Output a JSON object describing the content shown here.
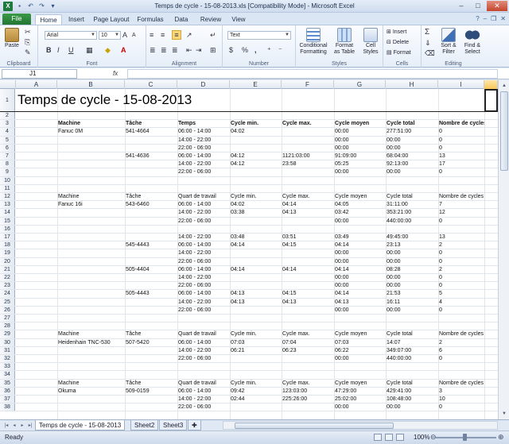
{
  "app": {
    "window_title": "Temps de cycle - 15-08-2013.xls  [Compatibility Mode]  -  Microsoft Excel",
    "logo_letter": "X",
    "accent_color": "#217346"
  },
  "ribbon_tabs": [
    "File",
    "Home",
    "Insert",
    "Page Layout",
    "Formulas",
    "Data",
    "Review",
    "View"
  ],
  "ribbon": {
    "clipboard": {
      "paste": "Paste",
      "label": "Clipboard"
    },
    "font": {
      "name": "Arial",
      "size": "10",
      "label": "Font",
      "bold": "B",
      "italic": "I",
      "underline": "U"
    },
    "alignment": {
      "label": "Alignment"
    },
    "number": {
      "format": "Text",
      "label": "Number",
      "percent": "%",
      "comma": ","
    },
    "styles": {
      "conditional": "Conditional Formatting",
      "format_table": "Format as Table",
      "cell_styles": "Cell Styles",
      "label": "Styles"
    },
    "cells": {
      "insert": "Insert",
      "delete": "Delete",
      "format": "Format",
      "label": "Cells"
    },
    "editing": {
      "sort": "Sort & Filter",
      "find": "Find & Select",
      "label": "Editing",
      "sigma": "Σ"
    }
  },
  "formula_bar": {
    "name_box": "J1",
    "fx": "fx",
    "value": ""
  },
  "columns": [
    "A",
    "B",
    "C",
    "D",
    "E",
    "F",
    "G",
    "H",
    "I"
  ],
  "sheet": {
    "title": "Temps de cycle - 15-08-2013",
    "rows": [
      {
        "n": "2",
        "c": [
          "",
          "",
          "",
          "",
          "",
          "",
          "",
          ""
        ]
      },
      {
        "n": "3",
        "bold": true,
        "c": [
          "Machine",
          "Tâche",
          "Temps",
          "Cycle min.",
          "Cycle max.",
          "Cycle moyen",
          "Cycle total",
          "Nombre de cycles"
        ]
      },
      {
        "n": "4",
        "c": [
          "Fanuc 0M",
          "541-4664",
          "06:00 - 14:00",
          "04:02",
          "",
          "00:00",
          "277:51:00",
          "0"
        ]
      },
      {
        "n": "5",
        "c": [
          "",
          "",
          "14:00 - 22:00",
          "",
          "",
          "00:00",
          "00:00",
          "0"
        ]
      },
      {
        "n": "6",
        "c": [
          "",
          "",
          "22:00 - 06:00",
          "",
          "",
          "00:00",
          "00:00",
          "0"
        ]
      },
      {
        "n": "7",
        "c": [
          "",
          "541-4636",
          "06:00 - 14:00",
          "04:12",
          "1121:03:00",
          "91:09:00",
          "68:04:00",
          "13"
        ]
      },
      {
        "n": "8",
        "c": [
          "",
          "",
          "14:00 - 22:00",
          "04:12",
          "23:58",
          "05:25",
          "92:13:00",
          "17"
        ]
      },
      {
        "n": "9",
        "c": [
          "",
          "",
          "22:00 - 06:00",
          "",
          "",
          "00:00",
          "00:00",
          "0"
        ]
      },
      {
        "n": "10",
        "c": [
          "",
          "",
          "",
          "",
          "",
          "",
          "",
          ""
        ]
      },
      {
        "n": "11",
        "c": [
          "",
          "",
          "",
          "",
          "",
          "",
          "",
          ""
        ]
      },
      {
        "n": "12",
        "c": [
          "Machine",
          "Tâche",
          "Quart de travail",
          "Cycle min.",
          "Cycle max.",
          "Cycle moyen",
          "Cycle total",
          "Nombre de cycles"
        ]
      },
      {
        "n": "13",
        "c": [
          "Fanuc 16i",
          "543-6460",
          "06:00 - 14:00",
          "04:02",
          "04:14",
          "04:05",
          "31:11:00",
          "7"
        ]
      },
      {
        "n": "14",
        "c": [
          "",
          "",
          "14:00 - 22:00",
          "03:38",
          "04:13",
          "03:42",
          "353:21:00",
          "12"
        ]
      },
      {
        "n": "15",
        "c": [
          "",
          "",
          "22:00 - 06:00",
          "",
          "",
          "00:00",
          "440:00:00",
          "0"
        ]
      },
      {
        "n": "16",
        "c": [
          "",
          "",
          "",
          "",
          "",
          "",
          "",
          ""
        ]
      },
      {
        "n": "17",
        "c": [
          "",
          "",
          "14:00 - 22:00",
          "03:48",
          "03:51",
          "03:49",
          "49:45:00",
          "13"
        ]
      },
      {
        "n": "18",
        "c": [
          "",
          "545-4443",
          "06:00 - 14:00",
          "04:14",
          "04:15",
          "04:14",
          "23:13",
          "2"
        ]
      },
      {
        "n": "19",
        "c": [
          "",
          "",
          "14:00 - 22:00",
          "",
          "",
          "00:00",
          "00:00",
          "0"
        ]
      },
      {
        "n": "20",
        "c": [
          "",
          "",
          "22:00 - 06:00",
          "",
          "",
          "00:00",
          "00:00",
          "0"
        ]
      },
      {
        "n": "21",
        "c": [
          "",
          "505-4404",
          "06:00 - 14:00",
          "04:14",
          "04:14",
          "04:14",
          "08:28",
          "2"
        ]
      },
      {
        "n": "22",
        "c": [
          "",
          "",
          "14:00 - 22:00",
          "",
          "",
          "00:00",
          "00:00",
          "0"
        ]
      },
      {
        "n": "23",
        "c": [
          "",
          "",
          "22:00 - 06:00",
          "",
          "",
          "00:00",
          "00:00",
          "0"
        ]
      },
      {
        "n": "24",
        "c": [
          "",
          "505-4443",
          "06:00 - 14:00",
          "04:13",
          "04:15",
          "04:14",
          "21:53",
          "5"
        ]
      },
      {
        "n": "25",
        "c": [
          "",
          "",
          "14:00 - 22:00",
          "04:13",
          "04:13",
          "04:13",
          "16:11",
          "4"
        ]
      },
      {
        "n": "26",
        "c": [
          "",
          "",
          "22:00 - 06:00",
          "",
          "",
          "00:00",
          "00:00",
          "0"
        ]
      },
      {
        "n": "27",
        "c": [
          "",
          "",
          "",
          "",
          "",
          "",
          "",
          ""
        ]
      },
      {
        "n": "28",
        "c": [
          "",
          "",
          "",
          "",
          "",
          "",
          "",
          ""
        ]
      },
      {
        "n": "29",
        "c": [
          "Machine",
          "Tâche",
          "Quart de travail",
          "Cycle min.",
          "Cycle max.",
          "Cycle moyen",
          "Cycle total",
          "Nombre de cycles"
        ]
      },
      {
        "n": "30",
        "c": [
          "Heidenhain TNC-530",
          "507-5420",
          "06:00 - 14:00",
          "07:03",
          "07:04",
          "07:03",
          "14:07",
          "2"
        ]
      },
      {
        "n": "31",
        "c": [
          "",
          "",
          "14:00 - 22:00",
          "06:21",
          "06:23",
          "06:22",
          "349:07:00",
          "6"
        ]
      },
      {
        "n": "32",
        "c": [
          "",
          "",
          "22:00 - 06:00",
          "",
          "",
          "00:00",
          "440:00:00",
          "0"
        ]
      },
      {
        "n": "33",
        "c": [
          "",
          "",
          "",
          "",
          "",
          "",
          "",
          ""
        ]
      },
      {
        "n": "34",
        "c": [
          "",
          "",
          "",
          "",
          "",
          "",
          "",
          ""
        ]
      },
      {
        "n": "35",
        "c": [
          "Machine",
          "Tâche",
          "Quart de travail",
          "Cycle min.",
          "Cycle max.",
          "Cycle moyen",
          "Cycle total",
          "Nombre de cycles"
        ]
      },
      {
        "n": "36",
        "c": [
          "Okuma",
          "509-0159",
          "06:00 - 14:00",
          "09:42",
          "123:03:00",
          "47:29:00",
          "429:41:00",
          "3"
        ]
      },
      {
        "n": "37",
        "c": [
          "",
          "",
          "14:00 - 22:00",
          "02:44",
          "225:26:00",
          "25:02:00",
          "108:48:00",
          "10"
        ]
      },
      {
        "n": "38",
        "c": [
          "",
          "",
          "22:00 - 06:00",
          "",
          "",
          "00:00",
          "00:00",
          "0"
        ]
      }
    ]
  },
  "sheet_tabs": [
    "Temps de cycle - 15-08-2013",
    "Sheet2",
    "Sheet3"
  ],
  "status": {
    "ready": "Ready",
    "zoom": "100%"
  }
}
